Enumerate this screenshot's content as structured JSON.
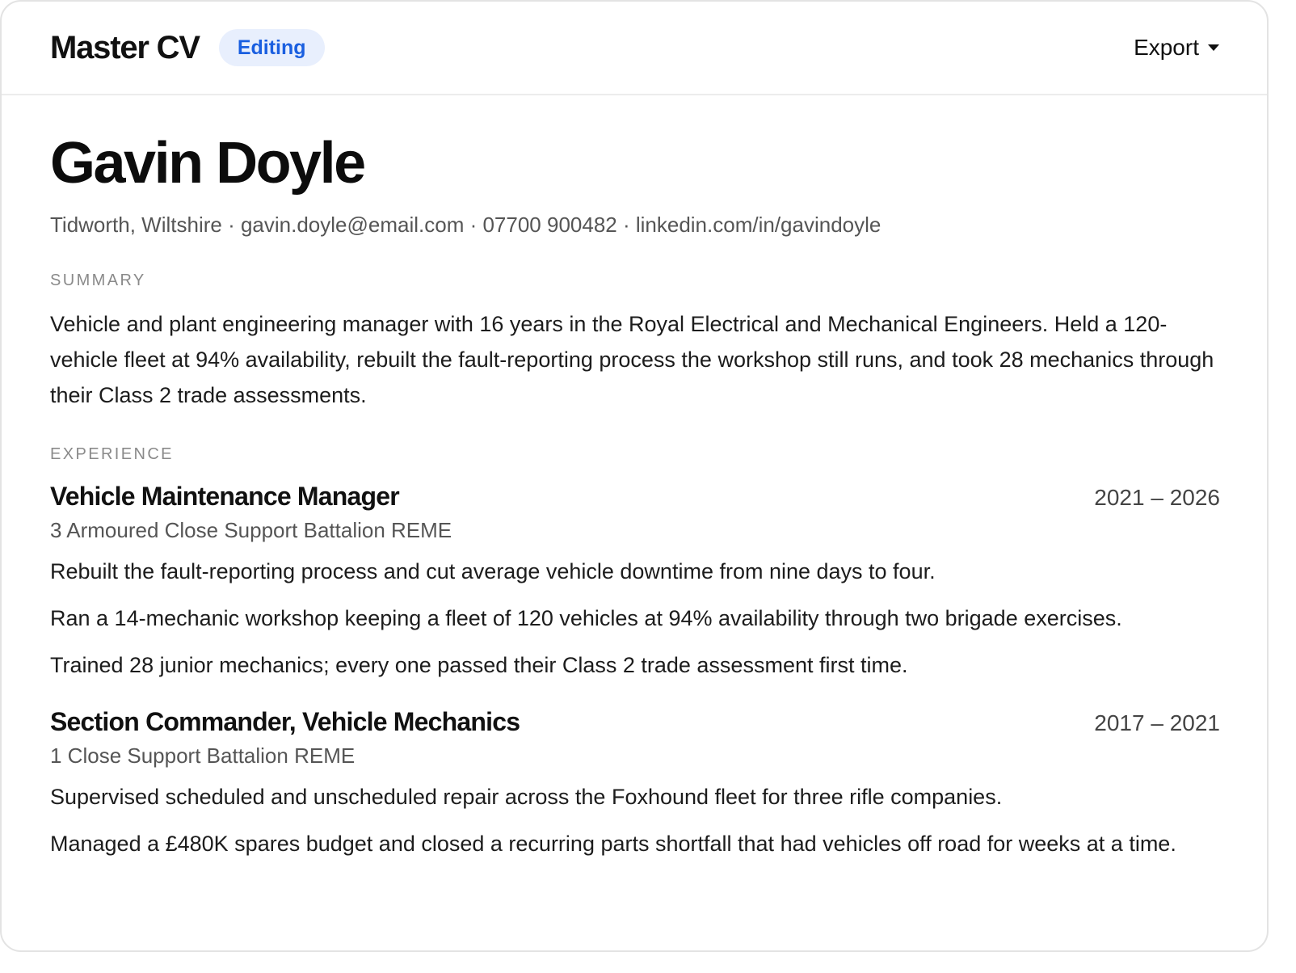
{
  "header": {
    "app_title": "Master CV",
    "status_badge": "Editing",
    "export_label": "Export",
    "colors": {
      "badge_bg": "#e8effd",
      "badge_text": "#1a5fe0"
    }
  },
  "cv": {
    "name": "Gavin Doyle",
    "contact": "Tidworth, Wiltshire · gavin.doyle@email.com · 07700 900482 · linkedin.com/in/gavindoyle",
    "summary_label": "SUMMARY",
    "summary": "Vehicle and plant engineering manager with 16 years in the Royal Electrical and Mechanical Engineers. Held a 120-vehicle fleet at 94% availability, rebuilt the fault-reporting process the workshop still runs, and took 28 mechanics through their Class 2 trade assessments.",
    "experience_label": "EXPERIENCE",
    "jobs": [
      {
        "title": "Vehicle Maintenance Manager",
        "dates": "2021 – 2026",
        "org": "3 Armoured Close Support Battalion REME",
        "bullets": [
          "Rebuilt the fault-reporting process and cut average vehicle downtime from nine days to four.",
          "Ran a 14-mechanic workshop keeping a fleet of 120 vehicles at 94% availability through two brigade exercises.",
          "Trained 28 junior mechanics; every one passed their Class 2 trade assessment first time."
        ]
      },
      {
        "title": "Section Commander, Vehicle Mechanics",
        "dates": "2017 – 2021",
        "org": "1 Close Support Battalion REME",
        "bullets": [
          "Supervised scheduled and unscheduled repair across the Foxhound fleet for three rifle companies.",
          "Managed a £480K spares budget and closed a recurring parts shortfall that had vehicles off road for weeks at a time."
        ]
      }
    ]
  }
}
